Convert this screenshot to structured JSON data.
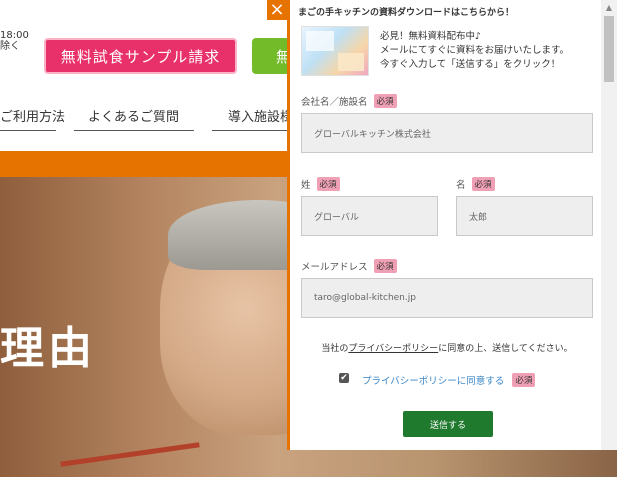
{
  "site": {
    "hours": "18:00",
    "hours_note": "除く",
    "sample_button": "無料試食サンプル請求",
    "green_button": "無",
    "nav": [
      "ご利用方法",
      "よくあるご質問",
      "導入施設様"
    ],
    "hero_title": "理由"
  },
  "popup": {
    "close_label": "×",
    "title": "まごの手キッチンの資料ダウンロードはこちらから！",
    "promo_lines": [
      "必見！無料資料配布中♪",
      "メールにてすぐに資料をお届けいたします。",
      "今すぐ入力して「送信する」をクリック！"
    ],
    "required": "必須",
    "company": {
      "label": "会社名／施設名",
      "placeholder": "グローバルキッチン株式会社"
    },
    "last_name": {
      "label": "姓",
      "placeholder": "グローバル"
    },
    "first_name": {
      "label": "名",
      "placeholder": "太郎"
    },
    "email": {
      "label": "メールアドレス",
      "placeholder": "taro@global-kitchen.jp"
    },
    "privacy_before": "当社の",
    "privacy_link": "プライバシーポリシー",
    "privacy_after": "に同意の上、送信してください。",
    "agree_label": "プライバシーポリシーに同意する",
    "agree_checked": true,
    "submit": "送信する"
  },
  "colors": {
    "accent": "#e67300",
    "pink": "#e8306a",
    "green": "#74bb2a",
    "submit": "#1f7a2e",
    "required_bg": "#f0a0b5"
  }
}
